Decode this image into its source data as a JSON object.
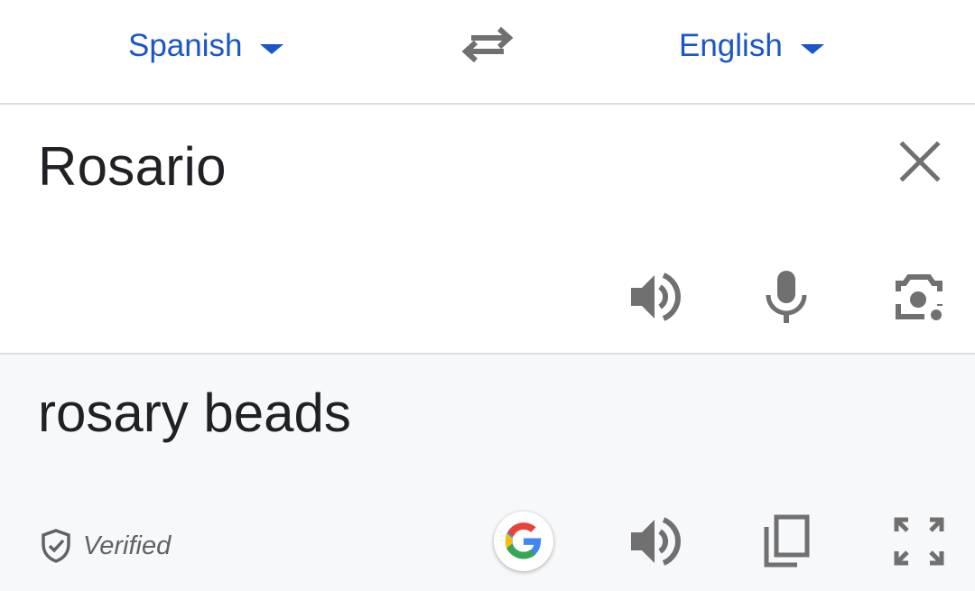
{
  "language_bar": {
    "source_language": "Spanish",
    "target_language": "English",
    "accent_color": "#1a56c8",
    "swap_icon": "swap-arrows-icon"
  },
  "source": {
    "text": "Rosario",
    "icons": [
      "close-icon",
      "speaker-icon",
      "microphone-icon",
      "camera-lens-icon"
    ]
  },
  "result": {
    "text": "rosary beads",
    "verified_label": "Verified",
    "icons": [
      "shield-check-icon",
      "google-logo-icon",
      "speaker-icon",
      "copy-icon",
      "fullscreen-icon"
    ],
    "background": "#f7f8fa"
  }
}
